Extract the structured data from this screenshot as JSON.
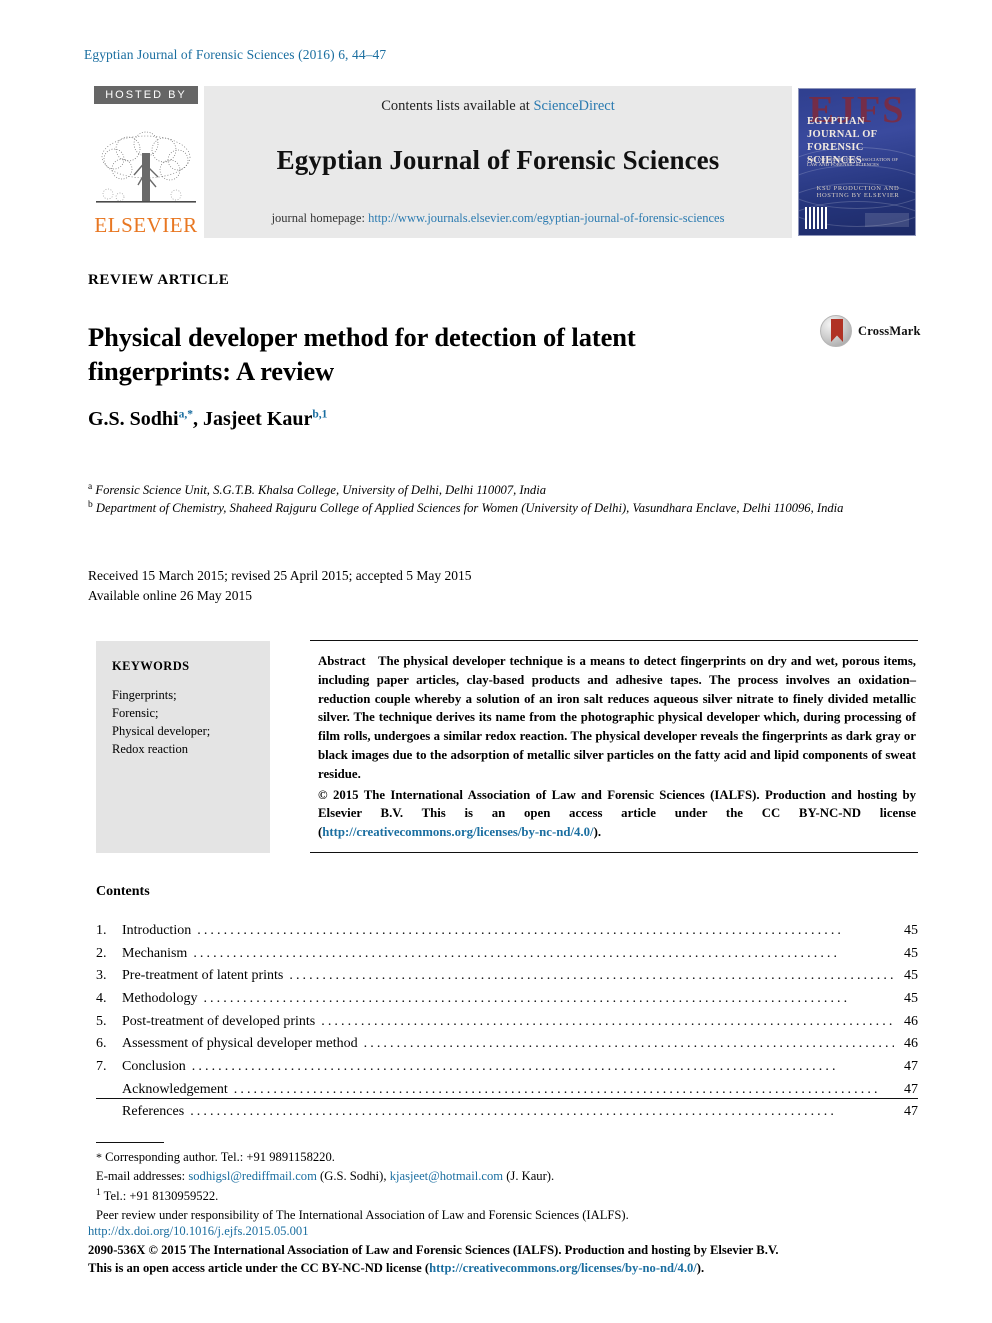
{
  "running_head": "Egyptian Journal of Forensic Sciences (2016) 6, 44–47",
  "banner": {
    "hosted_by": "HOSTED BY",
    "publisher": "ELSEVIER",
    "contents_prefix": "Contents lists available at ",
    "contents_link": "ScienceDirect",
    "journal_title": "Egyptian Journal of Forensic Sciences",
    "homepage_prefix": "journal homepage: ",
    "homepage_link": "http://www.journals.elsevier.com/egyptian-journal-of-forensic-sciences",
    "cover": {
      "ghost": "EJFS",
      "title": "EGYPTIAN JOURNAL OF FORENSIC SCIENCES",
      "subtitle": "THE INTERNATIONAL ASSOCIATION OF LAW AND FORENSIC SCIENCES",
      "publisher_line": "KSU  PRODUCTION AND HOSTING BY ELSEVIER"
    }
  },
  "article": {
    "type": "REVIEW ARTICLE",
    "title": "Physical developer method for detection of latent fingerprints: A review",
    "crossmark_label": "CrossMark",
    "authors": "G.S. Sodhi a,*, Jasjeet Kaur b,1",
    "author_parts": [
      {
        "name": "G.S. Sodhi",
        "marks": "a,*"
      },
      {
        "name": "Jasjeet Kaur",
        "marks": "b,1"
      }
    ],
    "affiliations": [
      {
        "mark": "a",
        "text": "Forensic Science Unit, S.G.T.B. Khalsa College, University of Delhi, Delhi 110007, India"
      },
      {
        "mark": "b",
        "text": "Department of Chemistry, Shaheed Rajguru College of Applied Sciences for Women (University of Delhi), Vasundhara Enclave, Delhi 110096, India"
      }
    ],
    "history_line_1": "Received 15 March 2015; revised 25 April 2015; accepted 5 May 2015",
    "history_line_2": "Available online 26 May 2015"
  },
  "keywords": {
    "heading": "KEYWORDS",
    "items": [
      "Fingerprints;",
      "Forensic;",
      "Physical developer;",
      "Redox reaction"
    ]
  },
  "abstract": {
    "heading": "Abstract",
    "body": "The physical developer technique is a means to detect fingerprints on dry and wet, porous items, including paper articles, clay-based products and adhesive tapes. The process involves an oxidation–reduction couple whereby a solution of an iron salt reduces aqueous silver nitrate to finely divided metallic silver. The technique derives its name from the photographic physical developer which, during processing of film rolls, undergoes a similar redox reaction. The physical developer reveals the fingerprints as dark gray or black images due to the adsorption of metallic silver particles on the fatty acid and lipid components of sweat residue.",
    "copyright": "© 2015 The International Association of Law and Forensic Sciences (IALFS). Production and hosting by Elsevier B.V.  This is an open access article under the CC BY-NC-ND license (",
    "license_link": "http://creativecommons.org/licenses/by-nc-nd/4.0/",
    "copyright_tail": ")."
  },
  "contents": {
    "heading": "Contents",
    "rows": [
      {
        "num": "1.",
        "label": "Introduction",
        "page": "45"
      },
      {
        "num": "2.",
        "label": "Mechanism",
        "page": "45"
      },
      {
        "num": "3.",
        "label": "Pre-treatment of latent prints",
        "page": "45"
      },
      {
        "num": "4.",
        "label": "Methodology",
        "page": "45"
      },
      {
        "num": "5.",
        "label": "Post-treatment of developed prints",
        "page": "46"
      },
      {
        "num": "6.",
        "label": "Assessment of physical developer method",
        "page": "46"
      },
      {
        "num": "7.",
        "label": "Conclusion",
        "page": "47"
      },
      {
        "num": "",
        "label": "Acknowledgement",
        "page": "47"
      },
      {
        "num": "",
        "label": "References",
        "page": "47"
      }
    ]
  },
  "footnotes": {
    "corresponding": "Corresponding author. Tel.: +91 9891158220.",
    "email_label": "E-mail addresses:",
    "email1": "sodhigsl@rediffmail.com",
    "email1_owner": "(G.S. Sodhi),",
    "email2": "kjasjeet@hotmail.com",
    "email2_owner": "(J. Kaur).",
    "tel_mark": "1",
    "tel": "Tel.: +91 8130959522.",
    "peer_review": "Peer review under responsibility of The International Association of Law and Forensic Sciences (IALFS)."
  },
  "bottom": {
    "doi": "http://dx.doi.org/10.1016/j.ejfs.2015.05.001",
    "issn_line": "2090-536X © 2015 The International Association of Law and Forensic Sciences (IALFS). Production and hosting by Elsevier B.V.",
    "license_prefix": "This is an open access article under the CC BY-NC-ND license (",
    "license_link": "http://creativecommons.org/licenses/by-no-nd/4.0/",
    "license_tail": ")."
  },
  "colors": {
    "link": "#1a6ea0",
    "elsevier_orange": "#E87722",
    "banner_gray": "#e9e9e9",
    "keywords_gray": "#e4e4e4",
    "crossmark_red": "#b03224"
  }
}
